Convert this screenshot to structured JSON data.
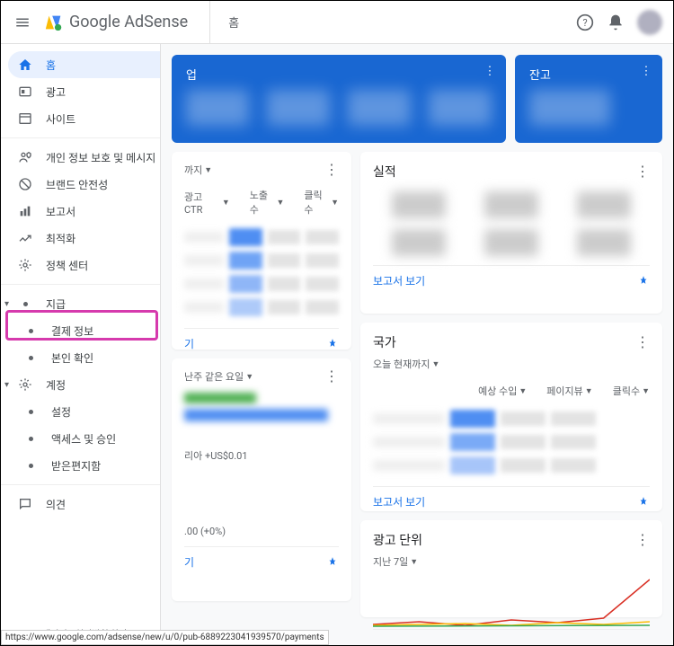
{
  "header": {
    "app_name": "Google AdSense",
    "tab": "홈"
  },
  "sidebar": {
    "items": [
      {
        "label": "홈",
        "icon": "home"
      },
      {
        "label": "광고",
        "icon": "ad"
      },
      {
        "label": "사이트",
        "icon": "site"
      }
    ],
    "items2": [
      {
        "label": "개인 정보 보호 및 메시지",
        "icon": "privacy"
      },
      {
        "label": "브랜드 안전성",
        "icon": "brand"
      },
      {
        "label": "보고서",
        "icon": "report"
      },
      {
        "label": "최적화",
        "icon": "optimize"
      },
      {
        "label": "정책 센터",
        "icon": "policy"
      }
    ],
    "payments": {
      "parent": "지급",
      "children": [
        "결제 정보",
        "본인 확인"
      ]
    },
    "account": {
      "parent": "계정",
      "children": [
        "설정",
        "액세스 및 승인",
        "받은편지함"
      ]
    },
    "feedback": "의견",
    "footer": "Google   개인정보처리방침   약관"
  },
  "status_url": "https://www.google.com/adsense/new/u/0/pub-6889223041939570/payments",
  "cards": {
    "blue1_suffix": "업",
    "blue2_title": "잔고",
    "perf_card": {
      "title_suffix": "까지",
      "headers": [
        "광고 CTR",
        "노출수",
        "클릭수"
      ],
      "foot_link": "기"
    },
    "results": {
      "title": "실적",
      "foot_link": "보고서 보기"
    },
    "countries": {
      "title": "국가",
      "filter": "오늘 현재까지",
      "headers": [
        "예상 수입",
        "페이지뷰",
        "클릭수"
      ],
      "foot_link": "보고서 보기"
    },
    "mid_card": {
      "filter": "난주 같은 요일",
      "row_text": "리아 +US$0.01",
      "footer_text": ".00 (+0%)"
    },
    "ad_unit": {
      "title": "광고 단위",
      "filter": "지난 7일"
    }
  }
}
